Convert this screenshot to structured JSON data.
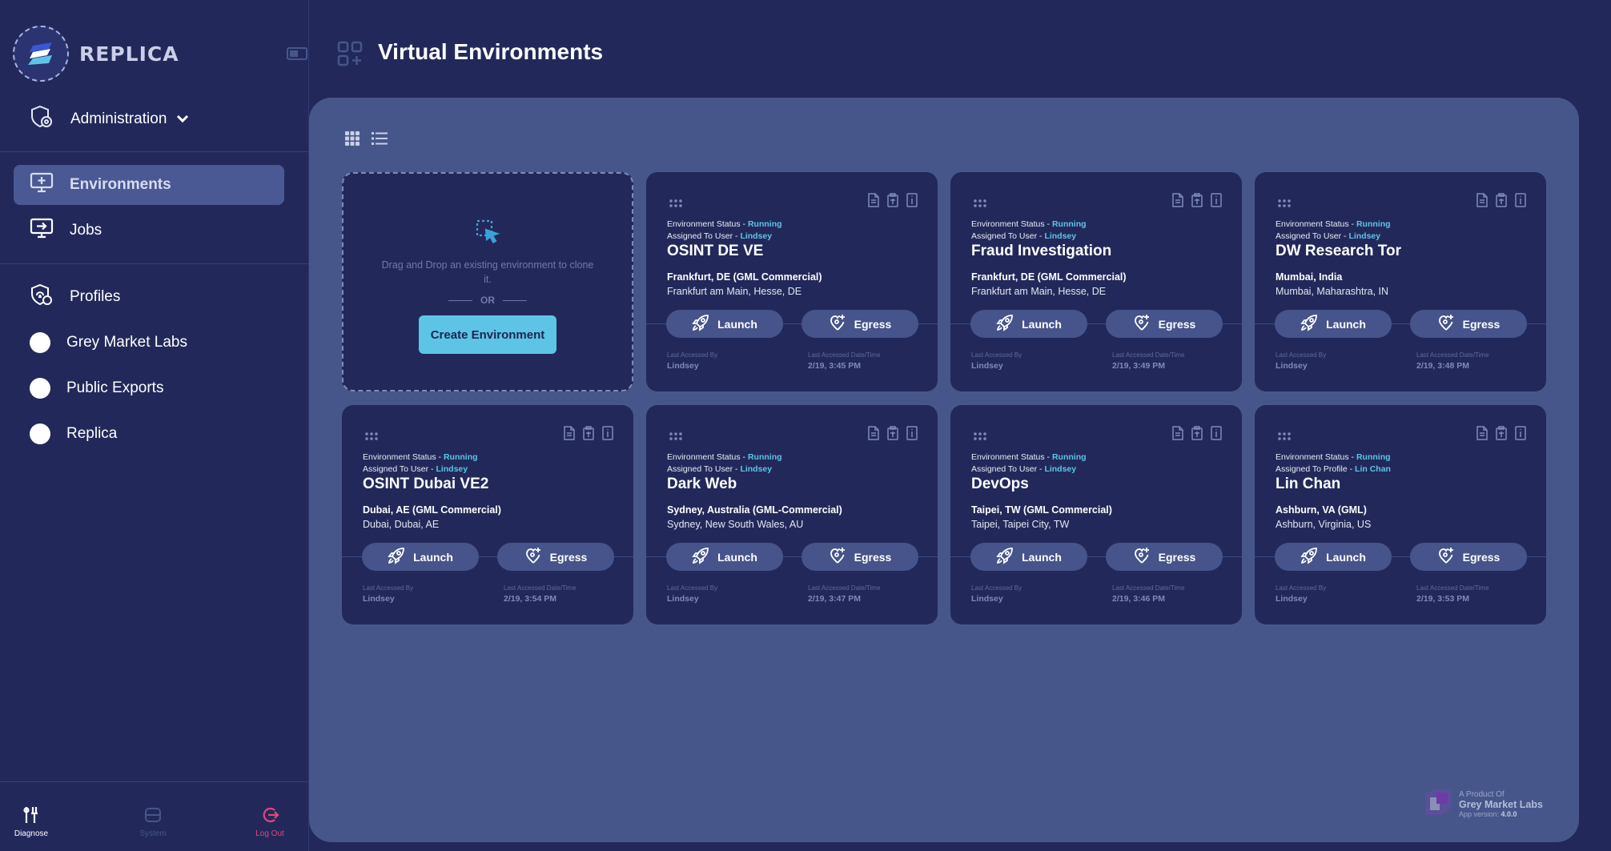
{
  "app": {
    "brand": "REPLICA"
  },
  "sidebar": {
    "admin_label": "Administration",
    "items": [
      {
        "label": "Environments",
        "icon": "monitor-plus-icon",
        "active": true
      },
      {
        "label": "Jobs",
        "icon": "monitor-arrow-icon",
        "active": false
      },
      {
        "label": "Profiles",
        "icon": "shield-fingerprint-icon",
        "active": false
      },
      {
        "label": "Grey Market Labs",
        "icon": "circle-icon",
        "active": false
      },
      {
        "label": "Public Exports",
        "icon": "circle-icon",
        "active": false
      },
      {
        "label": "Replica",
        "icon": "circle-icon",
        "active": false
      }
    ],
    "footer": {
      "diagnose": "Diagnose",
      "system": "System",
      "logout": "Log Out"
    }
  },
  "header": {
    "title": "Virtual Environments"
  },
  "drop_card": {
    "text": "Drag and Drop an existing environment to clone it.",
    "or": "OR",
    "button": "Create Environment"
  },
  "labels": {
    "env_status": "Environment Status - ",
    "assigned_user": "Assigned To User - ",
    "assigned_profile": "Assigned To Profile - ",
    "launch": "Launch",
    "egress": "Egress",
    "last_by": "Last Accessed By",
    "last_date": "Last Accessed Date/Time"
  },
  "environments": [
    {
      "name": "OSINT DE VE",
      "status": "Running",
      "assigned_label": "Assigned To User - ",
      "assigned": "Lindsey",
      "location": "Frankfurt, DE (GML Commercial)",
      "sublocation": "Frankfurt am Main, Hesse, DE",
      "last_by": "Lindsey",
      "last_date": "2/19, 3:45 PM"
    },
    {
      "name": "Fraud Investigation",
      "status": "Running",
      "assigned_label": "Assigned To User - ",
      "assigned": "Lindsey",
      "location": "Frankfurt, DE (GML Commercial)",
      "sublocation": "Frankfurt am Main, Hesse, DE",
      "last_by": "Lindsey",
      "last_date": "2/19, 3:49 PM"
    },
    {
      "name": "DW Research Tor",
      "status": "Running",
      "assigned_label": "Assigned To User - ",
      "assigned": "Lindsey",
      "location": "Mumbai, India",
      "sublocation": "Mumbai, Maharashtra, IN",
      "last_by": "Lindsey",
      "last_date": "2/19, 3:48 PM"
    },
    {
      "name": "OSINT Dubai VE2",
      "status": "Running",
      "assigned_label": "Assigned To User - ",
      "assigned": "Lindsey",
      "location": "Dubai, AE (GML Commercial)",
      "sublocation": "Dubai, Dubai, AE",
      "last_by": "Lindsey",
      "last_date": "2/19, 3:54 PM"
    },
    {
      "name": "Dark Web",
      "status": "Running",
      "assigned_label": "Assigned To User - ",
      "assigned": "Lindsey",
      "location": "Sydney, Australia (GML-Commercial)",
      "sublocation": "Sydney, New South Wales, AU",
      "last_by": "Lindsey",
      "last_date": "2/19, 3:47 PM"
    },
    {
      "name": "DevOps",
      "status": "Running",
      "assigned_label": "Assigned To User - ",
      "assigned": "Lindsey",
      "location": "Taipei, TW (GML Commercial)",
      "sublocation": "Taipei, Taipei City, TW",
      "last_by": "Lindsey",
      "last_date": "2/19, 3:46 PM"
    },
    {
      "name": "Lin Chan",
      "status": "Running",
      "assigned_label": "Assigned To Profile - ",
      "assigned": "Lin Chan",
      "location": "Ashburn, VA (GML)",
      "sublocation": "Ashburn, Virginia, US",
      "last_by": "Lindsey",
      "last_date": "2/19, 3:53 PM"
    }
  ],
  "brand_footer": {
    "product_of": "A Product Of",
    "company": "Grey Market Labs",
    "version_label": "App version: ",
    "version": "4.0.0"
  },
  "colors": {
    "accent": "#5ec4e6",
    "logout": "#e2457c",
    "sidebar_bg": "#22295a",
    "panel_bg": "#47568a"
  }
}
